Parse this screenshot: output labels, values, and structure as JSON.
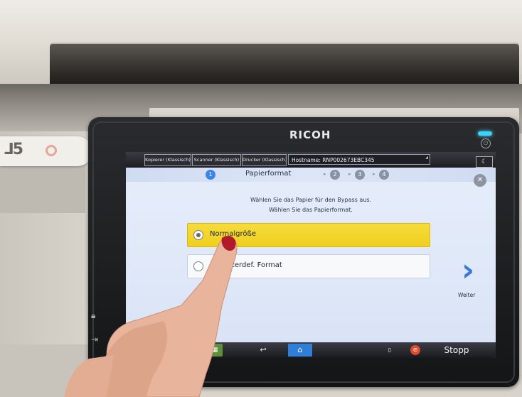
{
  "device": {
    "brand": "RICOH"
  },
  "topbar": {
    "tabs": [
      "Kopierer (Klassisch)",
      "Scanner (Klassisch)",
      "Drucker (Klassisch)"
    ],
    "hostname": "Hostname: RNP002673EBC345"
  },
  "wizard": {
    "current_step": "1",
    "title": "Papierformat",
    "steps": [
      "2",
      "3",
      "4"
    ]
  },
  "instructions": {
    "line1": "Wählen Sie das Papier für den Bypass aus.",
    "line2": "Wählen Sie das Papierformat."
  },
  "options": [
    {
      "label": "Normalgröße",
      "selected": true
    },
    {
      "label": "Benutzerdef. Format",
      "selected": false
    }
  ],
  "next": {
    "label": "Weiter"
  },
  "bottombar": {
    "stop_label": "Stopp"
  },
  "colors": {
    "selected_option": "#f2d42a",
    "accent_blue": "#3a86e8",
    "stop_red": "#e04a2e"
  }
}
